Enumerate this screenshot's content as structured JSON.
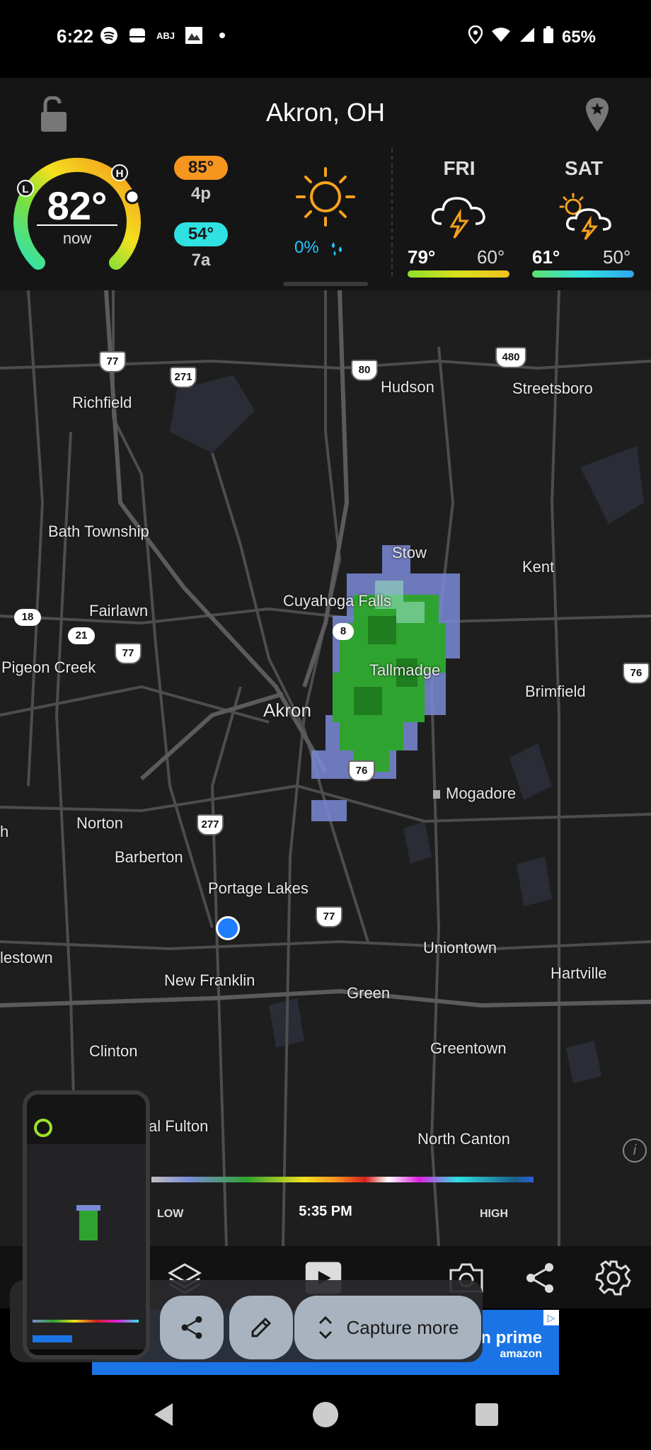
{
  "status_bar": {
    "time": "6:22",
    "left_icons": [
      "spotify-icon",
      "storage-icon",
      "abj-icon",
      "photo-icon",
      "dot"
    ],
    "abj_text": "ABJ",
    "battery": "65%",
    "right_icons": [
      "location-icon",
      "wifi-icon",
      "signal-icon",
      "battery-icon"
    ]
  },
  "header": {
    "location": "Akron, OH",
    "current": {
      "temp": "82°",
      "label": "now",
      "gauge_low_marker": "L",
      "gauge_high_marker": "H"
    },
    "high": {
      "temp": "85°",
      "time": "4p"
    },
    "low": {
      "temp": "54°",
      "time": "7a"
    },
    "today": {
      "icon": "sun-icon",
      "precip": "0%"
    },
    "forecast": [
      {
        "day": "FRI",
        "icon": "thunderstorm-icon",
        "hi": "79°",
        "lo": "60°"
      },
      {
        "day": "SAT",
        "icon": "partly-sunny-thunderstorm-icon",
        "hi": "61°",
        "lo": "50°"
      }
    ]
  },
  "map": {
    "places": [
      "Richfield",
      "Hudson",
      "Streetsboro",
      "Bath Township",
      "Stow",
      "Kent",
      "Cuyahoga Falls",
      "Fairlawn",
      "Pigeon Creek",
      "Tallmadge",
      "Brimfield",
      "Akron",
      "Mogadore",
      "Norton",
      "Barberton",
      "Portage Lakes",
      "Uniontown",
      "Hartville",
      "lestown",
      "New Franklin",
      "Green",
      "Clinton",
      "Greentown",
      "al Fulton",
      "North Canton",
      "h"
    ],
    "shields": [
      "77",
      "271",
      "80",
      "480",
      "18",
      "21",
      "77",
      "8",
      "76",
      "76",
      "277",
      "77"
    ],
    "legend": {
      "low": "LOW",
      "time": "5:35 PM",
      "high": "HIGH"
    }
  },
  "toolbar": {
    "buttons": [
      "layers-icon",
      "play-icon",
      "camera-icon",
      "share-icon",
      "settings-icon"
    ]
  },
  "ad": {
    "text": "'s on prime",
    "sub": "amazon",
    "badge": "▷"
  },
  "screenshot_overlay": {
    "buttons": [
      "share-icon",
      "edit-icon"
    ],
    "capture_more": "Capture more"
  },
  "colors": {
    "hi_pill": "#f7961e",
    "lo_pill": "#2fe1e1",
    "precip": "#23c8ff",
    "radar_green": "#2fa32f",
    "radar_blue": "#7a8ad6",
    "ad_blue": "#1a74e5"
  }
}
